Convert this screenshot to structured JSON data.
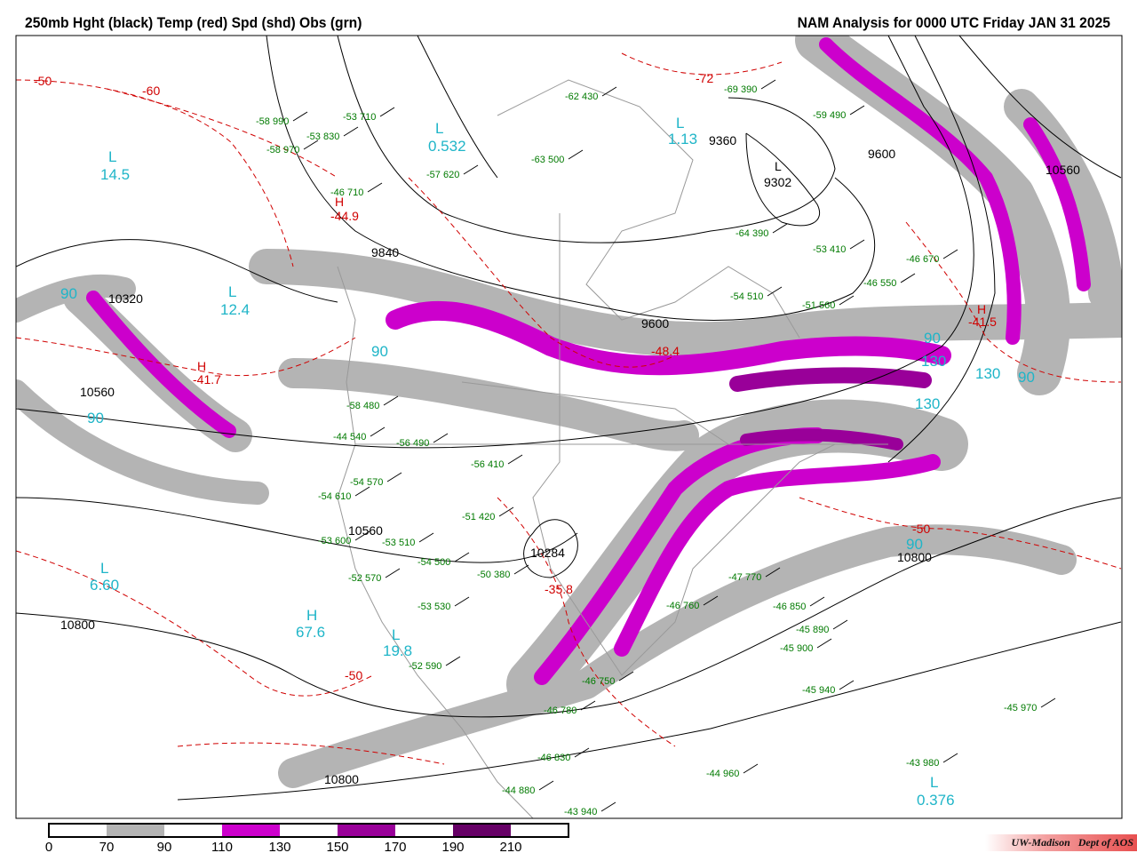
{
  "header": {
    "title": "250mb Hght (black) Temp (red) Spd (shd) Obs (grn)",
    "subtitle": "NAM Analysis for 0000 UTC Friday  JAN 31 2025"
  },
  "colorbar": {
    "ticks": [
      "0",
      "70",
      "90",
      "110",
      "130",
      "150",
      "170",
      "190",
      "210"
    ],
    "colors": [
      "#ffffff",
      "#b4b4b4",
      "#ffffff",
      "#cc00cc",
      "#ffffff",
      "#990099",
      "#ffffff",
      "#660066",
      "#ffffff"
    ]
  },
  "credit": "UW-Madison   Dept of AOS",
  "colors": {
    "height": "#000000",
    "temp": "#d00000",
    "obs": "#007a00",
    "speed_label": "#1fb5c8",
    "jet_70": "#b4b4b4",
    "jet_110": "#cc00cc",
    "jet_150": "#990099"
  },
  "centers": [
    {
      "letter": "L",
      "value": "14.5"
    },
    {
      "letter": "L",
      "value": "12.4"
    },
    {
      "letter": "L",
      "value": "6.60"
    },
    {
      "letter": "H",
      "value": "67.6"
    },
    {
      "letter": "L",
      "value": "19.8"
    },
    {
      "letter": "L",
      "value": "1.13"
    },
    {
      "letter": "L",
      "value": "0.376"
    },
    {
      "letter": "L",
      "value": "0.532"
    }
  ],
  "height_labels": [
    "10560",
    "10320",
    "9840",
    "10560",
    "10284",
    "10800",
    "10800",
    "10800",
    "9600",
    "10560",
    "9360",
    "9302",
    "9600"
  ],
  "height_low": "L",
  "temp_labels": [
    "-50",
    "-60",
    "-44.9",
    "-41.7",
    "-48.4",
    "-41.5",
    "-35.8",
    "-50",
    "-50",
    "-72"
  ],
  "temp_highs": [
    "H",
    "H",
    "H"
  ],
  "speed_labels": [
    "90",
    "90",
    "90",
    "130",
    "130",
    "90",
    "130",
    "90",
    "90"
  ],
  "observations": [
    {
      "t": "-58",
      "z": "990"
    },
    {
      "t": "-53",
      "z": "830"
    },
    {
      "t": "-58",
      "z": "970"
    },
    {
      "t": "-53",
      "z": "710"
    },
    {
      "t": "-46",
      "z": "710"
    },
    {
      "t": "-57",
      "z": "620"
    },
    {
      "t": "-63",
      "z": "500"
    },
    {
      "t": "-62",
      "z": "430"
    },
    {
      "t": "-69",
      "z": "390"
    },
    {
      "t": "-59",
      "z": "490"
    },
    {
      "t": "-64",
      "z": "390"
    },
    {
      "t": "-53",
      "z": "410"
    },
    {
      "t": "-46",
      "z": "670"
    },
    {
      "t": "-46",
      "z": "550"
    },
    {
      "t": "-51",
      "z": "560"
    },
    {
      "t": "-54",
      "z": "510"
    },
    {
      "t": "-58",
      "z": "480"
    },
    {
      "t": "-44",
      "z": "540"
    },
    {
      "t": "-56",
      "z": "490"
    },
    {
      "t": "-54",
      "z": "570"
    },
    {
      "t": "-56",
      "z": "410"
    },
    {
      "t": "-54",
      "z": "610"
    },
    {
      "t": "-53",
      "z": "600"
    },
    {
      "t": "-53",
      "z": "510"
    },
    {
      "t": "-54",
      "z": "500"
    },
    {
      "t": "-52",
      "z": "570"
    },
    {
      "t": "-53",
      "z": "530"
    },
    {
      "t": "-50",
      "z": "380"
    },
    {
      "t": "-51",
      "z": "420"
    },
    {
      "t": "-45",
      "z": "900"
    },
    {
      "t": "-45",
      "z": "940"
    },
    {
      "t": "-46",
      "z": "850"
    },
    {
      "t": "-47",
      "z": "770"
    },
    {
      "t": "-46",
      "z": "760"
    },
    {
      "t": "-46",
      "z": "830"
    },
    {
      "t": "-44",
      "z": "960"
    },
    {
      "t": "-43",
      "z": "980"
    },
    {
      "t": "-44",
      "z": "880"
    },
    {
      "t": "-43",
      "z": "940"
    },
    {
      "t": "-45",
      "z": "970"
    },
    {
      "t": "-52",
      "z": "590"
    },
    {
      "t": "-46",
      "z": "780"
    },
    {
      "t": "-46",
      "z": "750"
    },
    {
      "t": "-45",
      "z": "890"
    }
  ]
}
